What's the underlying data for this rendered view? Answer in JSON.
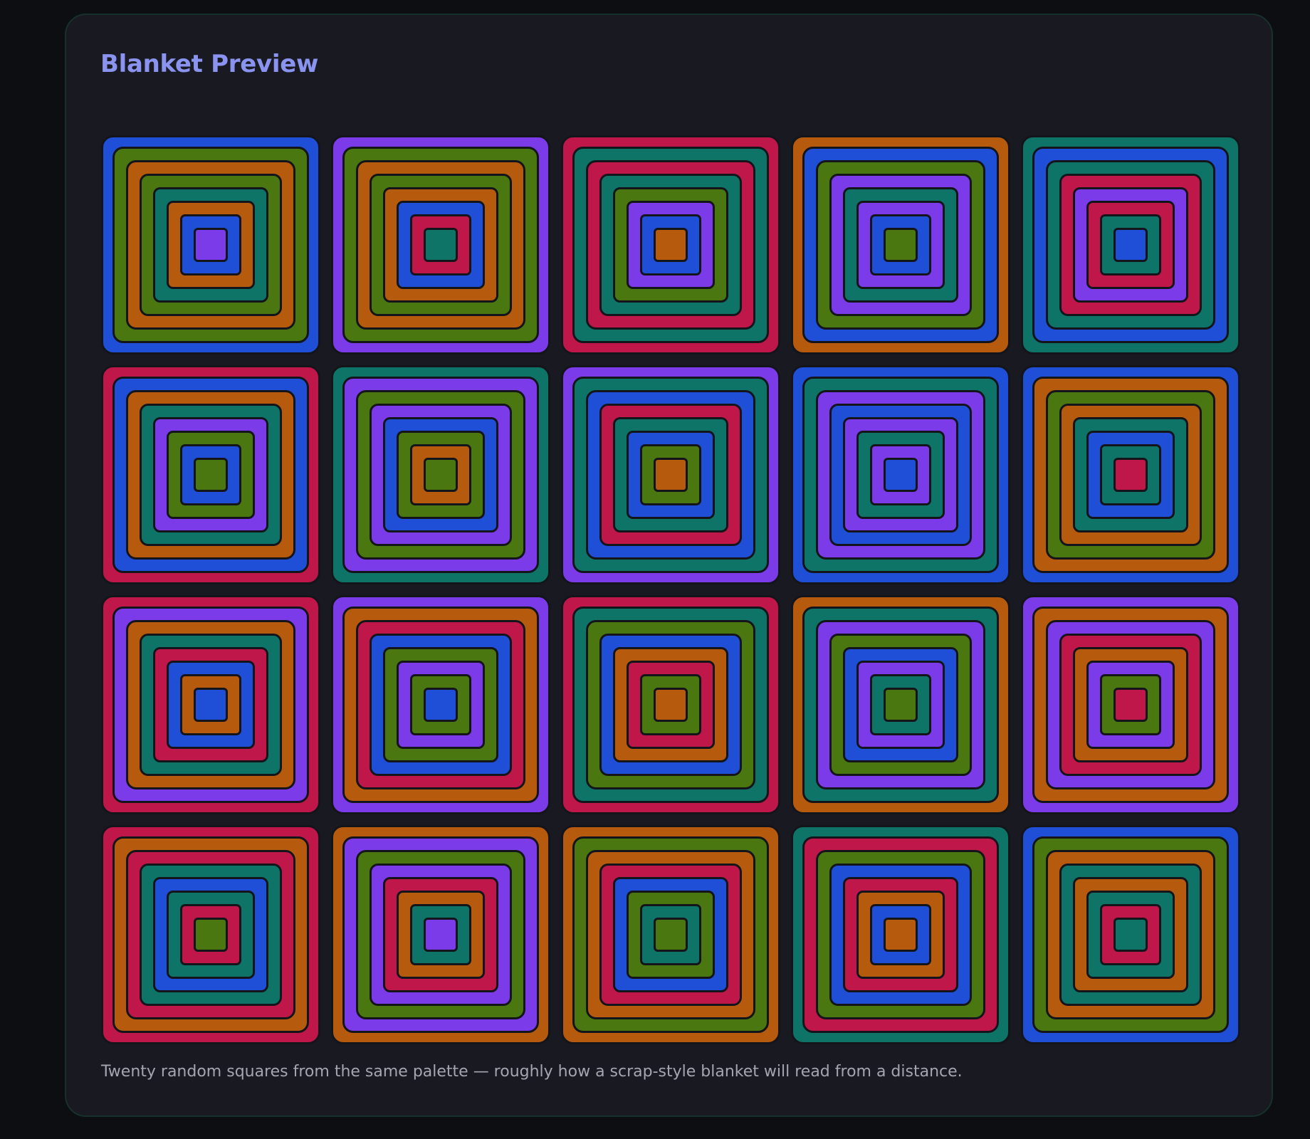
{
  "panel": {
    "title": "Blanket Preview",
    "caption": "Twenty random squares from the same palette — roughly how a scrap-style blanket will read from a distance."
  },
  "palette": {
    "blue": "#1f4fd6",
    "purple": "#7b3be8",
    "crimson": "#c0174a",
    "orange": "#b65a0e",
    "green": "#4b7710",
    "teal": "#0f7468",
    "outline": "#14151b"
  },
  "squares": [
    {
      "rounds": [
        "blue",
        "green",
        "orange",
        "green",
        "teal",
        "orange",
        "blue",
        "purple"
      ]
    },
    {
      "rounds": [
        "purple",
        "green",
        "orange",
        "green",
        "orange",
        "blue",
        "crimson",
        "teal"
      ]
    },
    {
      "rounds": [
        "crimson",
        "teal",
        "crimson",
        "teal",
        "green",
        "purple",
        "blue",
        "orange"
      ]
    },
    {
      "rounds": [
        "orange",
        "blue",
        "green",
        "purple",
        "teal",
        "purple",
        "blue",
        "green"
      ]
    },
    {
      "rounds": [
        "teal",
        "blue",
        "teal",
        "crimson",
        "purple",
        "crimson",
        "teal",
        "blue"
      ]
    },
    {
      "rounds": [
        "crimson",
        "blue",
        "orange",
        "teal",
        "purple",
        "green",
        "blue",
        "green"
      ]
    },
    {
      "rounds": [
        "teal",
        "purple",
        "green",
        "purple",
        "blue",
        "green",
        "orange",
        "green"
      ]
    },
    {
      "rounds": [
        "purple",
        "teal",
        "blue",
        "crimson",
        "teal",
        "blue",
        "green",
        "orange"
      ]
    },
    {
      "rounds": [
        "blue",
        "teal",
        "purple",
        "blue",
        "purple",
        "teal",
        "purple",
        "blue"
      ]
    },
    {
      "rounds": [
        "blue",
        "orange",
        "green",
        "orange",
        "teal",
        "blue",
        "teal",
        "crimson"
      ]
    },
    {
      "rounds": [
        "crimson",
        "purple",
        "orange",
        "teal",
        "crimson",
        "blue",
        "orange",
        "blue"
      ]
    },
    {
      "rounds": [
        "purple",
        "orange",
        "crimson",
        "blue",
        "green",
        "purple",
        "green",
        "blue"
      ]
    },
    {
      "rounds": [
        "crimson",
        "teal",
        "green",
        "blue",
        "orange",
        "crimson",
        "green",
        "orange"
      ]
    },
    {
      "rounds": [
        "orange",
        "teal",
        "purple",
        "green",
        "blue",
        "purple",
        "teal",
        "green"
      ]
    },
    {
      "rounds": [
        "purple",
        "orange",
        "purple",
        "crimson",
        "orange",
        "purple",
        "green",
        "crimson"
      ]
    },
    {
      "rounds": [
        "crimson",
        "orange",
        "crimson",
        "teal",
        "blue",
        "teal",
        "crimson",
        "green"
      ]
    },
    {
      "rounds": [
        "orange",
        "purple",
        "green",
        "purple",
        "crimson",
        "orange",
        "teal",
        "purple"
      ]
    },
    {
      "rounds": [
        "orange",
        "green",
        "orange",
        "crimson",
        "blue",
        "green",
        "teal",
        "green"
      ]
    },
    {
      "rounds": [
        "teal",
        "crimson",
        "green",
        "blue",
        "crimson",
        "orange",
        "blue",
        "orange"
      ]
    },
    {
      "rounds": [
        "blue",
        "green",
        "orange",
        "teal",
        "orange",
        "teal",
        "crimson",
        "teal"
      ]
    }
  ]
}
